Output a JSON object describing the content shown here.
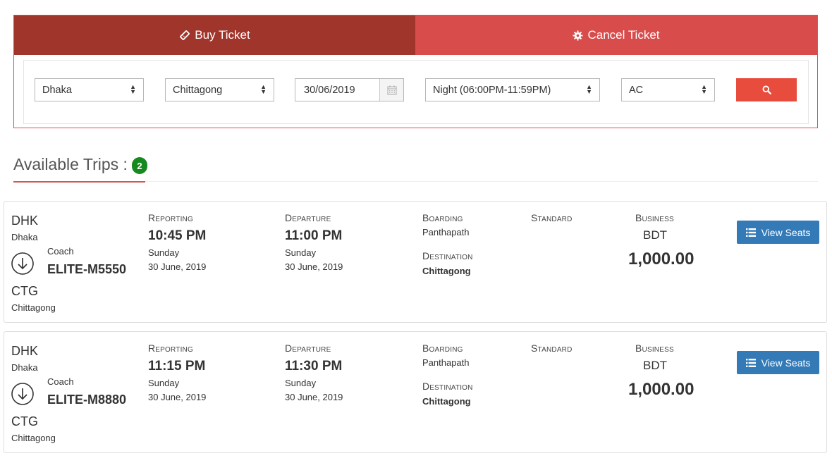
{
  "tabs": {
    "buy_label": "Buy Ticket",
    "cancel_label": "Cancel Ticket"
  },
  "search": {
    "from": "Dhaka",
    "to": "Chittagong",
    "date": "30/06/2019",
    "shift": "Night (06:00PM-11:59PM)",
    "class": "AC"
  },
  "available": {
    "label": "Available Trips :",
    "count": "2"
  },
  "labels": {
    "reporting": "Reporting",
    "departure": "Departure",
    "boarding": "Boarding",
    "destination": "Destination",
    "standard": "Standard",
    "business": "Business",
    "coach": "Coach",
    "view_seats": "View Seats"
  },
  "trips": [
    {
      "from_code": "DHK",
      "from_city": "Dhaka",
      "to_code": "CTG",
      "to_city": "Chittagong",
      "coach": "ELITE-M5550",
      "reporting_time": "10:45 PM",
      "reporting_day": "Sunday",
      "reporting_date": "30 June, 2019",
      "departure_time": "11:00 PM",
      "departure_day": "Sunday",
      "departure_date": "30 June, 2019",
      "boarding": "Panthapath",
      "destination": "Chittagong",
      "currency": "BDT",
      "price": "1,000.00"
    },
    {
      "from_code": "DHK",
      "from_city": "Dhaka",
      "to_code": "CTG",
      "to_city": "Chittagong",
      "coach": "ELITE-M8880",
      "reporting_time": "11:15 PM",
      "reporting_day": "Sunday",
      "reporting_date": "30 June, 2019",
      "departure_time": "11:30 PM",
      "departure_day": "Sunday",
      "departure_date": "30 June, 2019",
      "boarding": "Panthapath",
      "destination": "Chittagong",
      "currency": "BDT",
      "price": "1,000.00"
    }
  ],
  "colors": {
    "buy_tab": "#a0352c",
    "cancel_tab": "#d94c4c",
    "search_button": "#e84c3d",
    "view_button": "#337ab7",
    "badge": "#178a1f"
  }
}
